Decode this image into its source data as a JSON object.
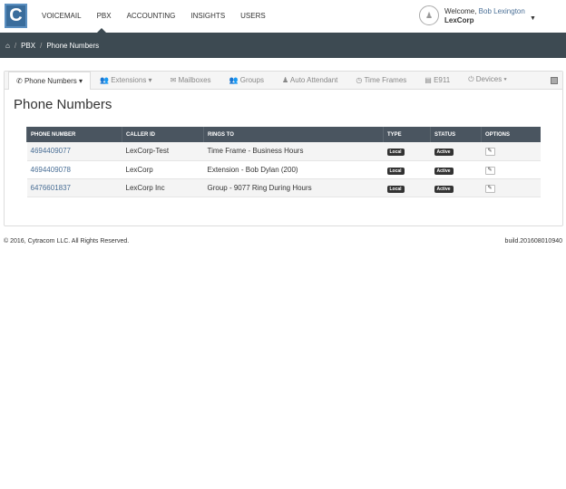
{
  "logo": "C",
  "nav": [
    "VOICEMAIL",
    "PBX",
    "ACCOUNTING",
    "INSIGHTS",
    "USERS"
  ],
  "user": {
    "welcome": "Welcome,",
    "name": "Bob Lexington",
    "org": "LexCorp"
  },
  "breadcrumb": [
    "PBX",
    "Phone Numbers"
  ],
  "tabs": [
    {
      "icon": "✆",
      "label": "Phone Numbers ▾"
    },
    {
      "icon": "👥",
      "label": "Extensions ▾"
    },
    {
      "icon": "✉",
      "label": "Mailboxes"
    },
    {
      "icon": "👥",
      "label": "Groups"
    },
    {
      "icon": "♟",
      "label": "Auto Attendant"
    },
    {
      "icon": "◷",
      "label": "Time Frames"
    },
    {
      "icon": "▤",
      "label": "E911"
    },
    {
      "icon": "⏻",
      "label": "Devices ▾"
    }
  ],
  "page_title": "Phone Numbers",
  "table": {
    "headers": [
      "PHONE NUMBER",
      "CALLER ID",
      "RINGS TO",
      "TYPE",
      "STATUS",
      "OPTIONS"
    ],
    "rows": [
      [
        "4694409077",
        "LexCorp-Test",
        "Time Frame - Business Hours",
        "Local",
        "Active"
      ],
      [
        "4694409078",
        "LexCorp",
        "Extension - Bob Dylan (200)",
        "Local",
        "Active"
      ],
      [
        "6476601837",
        "LexCorp Inc",
        "Group - 9077 Ring During Hours",
        "Local",
        "Active"
      ]
    ]
  },
  "footer": {
    "copyright": "© 2016, Cytracom LLC. All Rights Reserved.",
    "build": "build.201608010940"
  }
}
